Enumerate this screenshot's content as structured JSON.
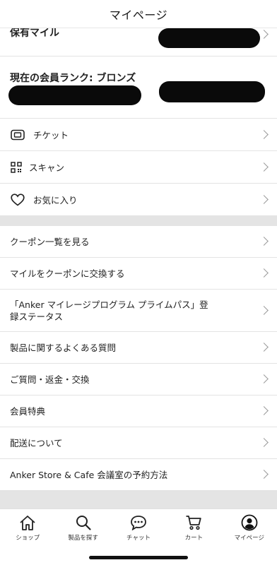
{
  "header": {
    "title": "マイページ"
  },
  "account": {
    "miles_label": "保有マイル",
    "rank_label": "現在の会員ランク: ブロンズ"
  },
  "quick_links": [
    {
      "label": "チケット",
      "icon": "ticket-icon"
    },
    {
      "label": "スキャン",
      "icon": "qr-scan-icon"
    },
    {
      "label": "お気に入り",
      "icon": "heart-icon"
    }
  ],
  "menu": [
    {
      "label": "クーポン一覧を見る"
    },
    {
      "label": "マイルをクーポンに交換する"
    },
    {
      "label": "「Anker マイレージプログラム プライムパス」登録ステータス"
    },
    {
      "label": "製品に関するよくある質問"
    },
    {
      "label": "ご質問・返金・交換"
    },
    {
      "label": "会員特典"
    },
    {
      "label": "配送について"
    },
    {
      "label": "Anker Store & Cafe 会議室の予約方法"
    }
  ],
  "tabbar": [
    {
      "label": "ショップ",
      "icon": "home-icon"
    },
    {
      "label": "製品を探す",
      "icon": "search-icon"
    },
    {
      "label": "チャット",
      "icon": "chat-icon"
    },
    {
      "label": "カート",
      "icon": "cart-icon"
    },
    {
      "label": "マイページ",
      "icon": "account-icon"
    }
  ]
}
